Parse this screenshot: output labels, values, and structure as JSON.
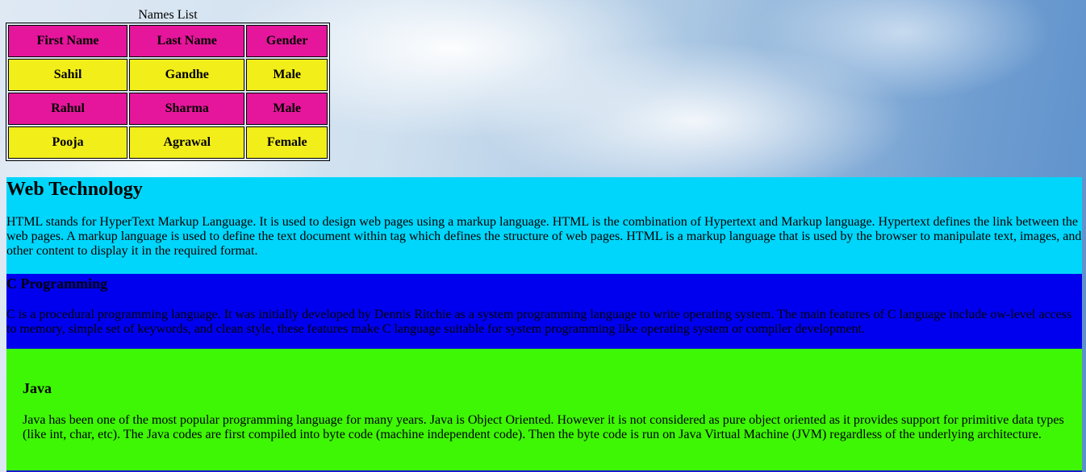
{
  "names_table": {
    "caption": "Names List",
    "headers": [
      "First Name",
      "Last Name",
      "Gender"
    ],
    "rows": [
      [
        "Sahil",
        "Gandhe",
        "Male"
      ],
      [
        "Rahul",
        "Sharma",
        "Male"
      ],
      [
        "Pooja",
        "Agrawal",
        "Female"
      ]
    ],
    "colors": {
      "pink": "#e5169b",
      "yellow": "#f2ee1a"
    }
  },
  "sections": {
    "web": {
      "title": "Web Technology",
      "text": "HTML stands for HyperText Markup Language. It is used to design web pages using a markup language. HTML is the combination of Hypertext and Markup language. Hypertext defines the link between the web pages. A markup language is used to define the text document within tag which defines the structure of web pages. HTML is a markup language that is used by the browser to manipulate text, images, and other content to display it in the required format.",
      "color": "#00d6fb"
    },
    "c": {
      "title": "C Programming",
      "text": "C is a procedural programming language. It was initially developed by Dennis Ritchie as a system programming language to write operating system. The main features of C language include ow-level access to memory, simple set of keywords, and clean style, these features make C language suitable for system programming like operating system or compiler development.",
      "color": "#0000ef"
    },
    "java": {
      "title": "Java",
      "text": "Java has been one of the most popular programming language for many years. Java is Object Oriented. However it is not considered as pure object oriented as it provides support for primitive data types (like int, char, etc). The Java codes are first compiled into byte code (machine independent code). Then the byte code is run on Java Virtual Machine (JVM) regardless of the underlying architecture.",
      "color": "#3ef704"
    }
  }
}
